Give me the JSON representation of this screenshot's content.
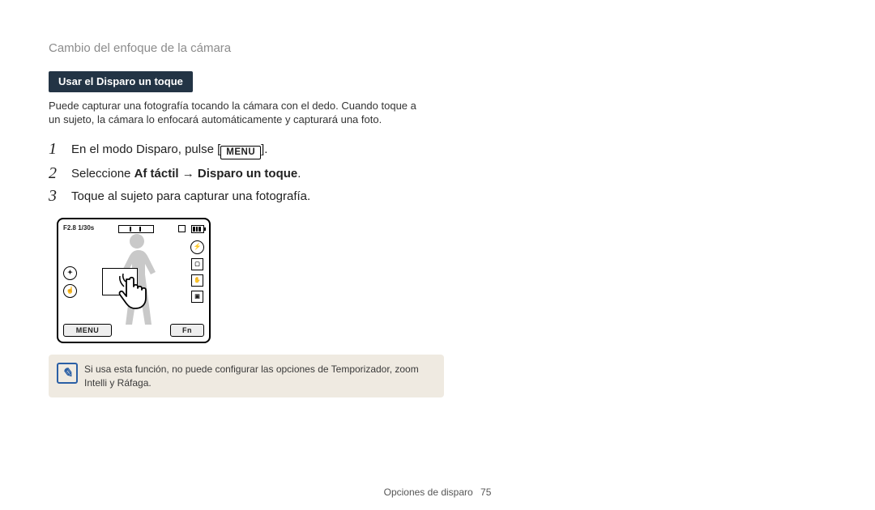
{
  "page": {
    "running_head": "Cambio del enfoque de la cámara",
    "footer_section": "Opciones de disparo",
    "footer_page": "75"
  },
  "section": {
    "title": "Usar el Disparo un toque",
    "intro": "Puede capturar una fotografía tocando la cámara con el dedo. Cuando toque a un sujeto, la cámara lo enfocará automáticamente y capturará una foto."
  },
  "steps": {
    "s1_prefix": "En el modo Disparo, pulse [",
    "s1_chip": "MENU",
    "s1_suffix": "].",
    "s2_prefix": "Seleccione ",
    "s2_bold_a": "Af táctil",
    "s2_arrow": " → ",
    "s2_bold_b": "Disparo un toque",
    "s2_suffix": ".",
    "s3": "Toque al sujeto para capturar una fotografía."
  },
  "lcd": {
    "exposure": "F2.8 1/30s",
    "menu_btn": "MENU",
    "fn_btn": "Fn"
  },
  "note": {
    "icon_text": "✎",
    "text": "Si usa esta función, no puede configurar las opciones de Temporizador, zoom Intelli y Ráfaga."
  }
}
